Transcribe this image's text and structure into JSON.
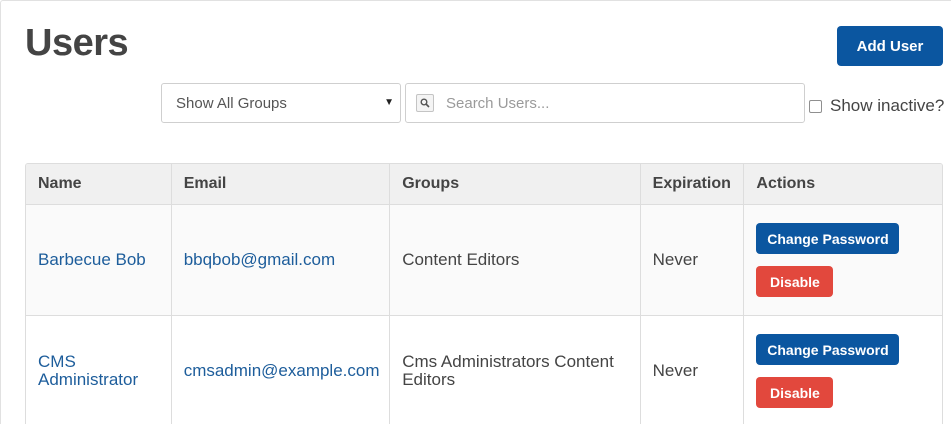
{
  "page": {
    "title": "Users"
  },
  "toolbar": {
    "add_user_label": "Add User",
    "group_filter": {
      "selected": "Show All Groups"
    },
    "search": {
      "placeholder": "Search Users..."
    },
    "show_inactive": {
      "label": "Show inactive?",
      "checked": false
    }
  },
  "table": {
    "headers": [
      "Name",
      "Email",
      "Groups",
      "Expiration",
      "Actions"
    ],
    "rows": [
      {
        "name": "Barbecue Bob",
        "email": "bbqbob@gmail.com",
        "groups": "Content Editors",
        "expiration": "Never",
        "change_password_label": "Change Password",
        "disable_label": "Disable"
      },
      {
        "name": "CMS Administrator",
        "email": "cmsadmin@example.com",
        "groups": "Cms Administrators Content Editors",
        "expiration": "Never",
        "change_password_label": "Change Password",
        "disable_label": "Disable"
      }
    ]
  },
  "colors": {
    "primary": "#0b56a0",
    "danger": "#e2483d",
    "link": "#1d5d9b"
  }
}
